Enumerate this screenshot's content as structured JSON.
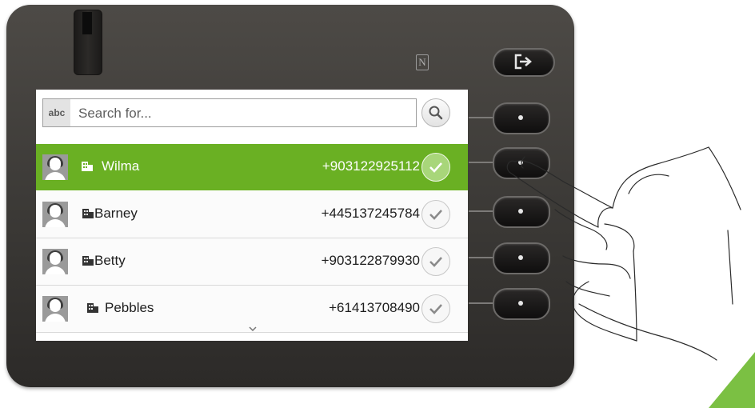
{
  "device": {
    "nfc_label": "N",
    "exit_icon": "exit-door-icon"
  },
  "search": {
    "mode_label": "abc",
    "placeholder": "Search for...",
    "button_icon": "search-icon"
  },
  "contacts": [
    {
      "name": "Wilma",
      "number": "+903122925112",
      "selected": true
    },
    {
      "name": "Barney",
      "number": "+445137245784",
      "selected": false
    },
    {
      "name": "Betty",
      "number": "+903122879930",
      "selected": false
    },
    {
      "name": "Pebbles",
      "number": "+61413708490",
      "selected": false
    }
  ],
  "colors": {
    "selection": "#6ab023",
    "device_body": "#3b3936"
  },
  "icons": {
    "avatar": "person-avatar-icon",
    "contact_type": "building-icon",
    "select": "checkmark-icon",
    "more": "chevron-down-icon"
  }
}
